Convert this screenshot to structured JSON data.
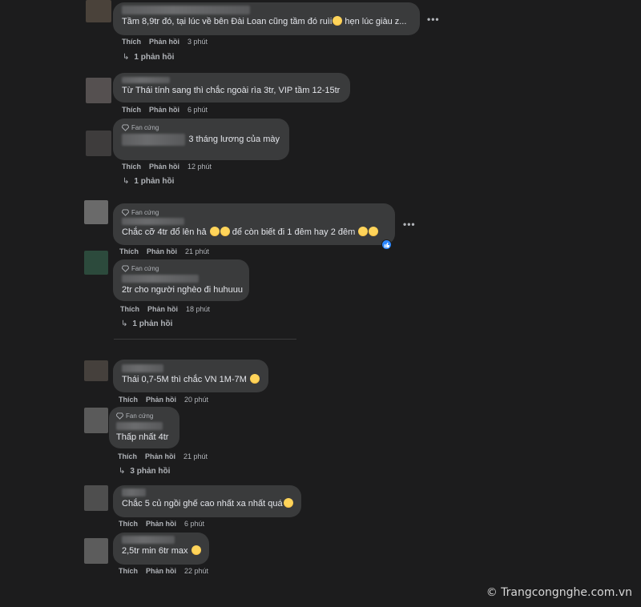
{
  "comments": [
    {
      "badge": "",
      "name": "",
      "text": "Tầm 8,9tr đó, tại lúc về bên Đài Loan cũng tầm đó ruìi",
      "text_tail": " hẹn lúc giàu z...",
      "like": "Thích",
      "reply": "Phản hồi",
      "time": "3 phút",
      "replies": "1 phản hồi"
    },
    {
      "badge": "",
      "name": "Nguyễn Vũ",
      "text": "Từ Thái tính sang thì chắc ngoài rìa 3tr, VIP tầm 12-15tr",
      "like": "Thích",
      "reply": "Phản hồi",
      "time": "6 phút"
    },
    {
      "badge": "Fan cứng",
      "name": "",
      "text": "3 tháng lương của mày",
      "like": "Thích",
      "reply": "Phản hồi",
      "time": "12 phút",
      "replies": "1 phản hồi"
    },
    {
      "badge": "Fan cứng",
      "name": "",
      "text": "Chắc cỡ 4tr đổ lên hả",
      "text_tail": " để còn biết đi 1 đêm hay 2 đêm",
      "like": "Thích",
      "reply": "Phản hồi",
      "time": "21 phút"
    },
    {
      "badge": "Fan cứng",
      "name": "",
      "text": "2tr cho người nghèo đi huhuuu",
      "like": "Thích",
      "reply": "Phản hồi",
      "time": "18 phút",
      "replies": "1 phản hồi"
    },
    {
      "badge": "",
      "name": "",
      "text": "Thái 0,7-5M thì chắc VN 1M-7M",
      "like": "Thích",
      "reply": "Phản hồi",
      "time": "20 phút"
    },
    {
      "badge": "Fan cứng",
      "name": "",
      "text": "Thấp nhất 4tr",
      "like": "Thích",
      "reply": "Phản hồi",
      "time": "21 phút",
      "replies": "3 phản hồi"
    },
    {
      "badge": "",
      "name": "",
      "text": "Chắc 5 củ ngồi ghế cao nhất xa nhất quá",
      "like": "Thích",
      "reply": "Phản hồi",
      "time": "6 phút"
    },
    {
      "badge": "",
      "name": "",
      "text": "2,5tr min 6tr max",
      "like": "Thích",
      "reply": "Phản hồi",
      "time": "22 phút"
    }
  ],
  "more_label": "•••",
  "watermark": "© Trangcongnghe.com.vn",
  "colors": {
    "background": "#1c1c1d",
    "bubble": "#3a3b3c",
    "text": "#e4e6eb",
    "muted": "#b0b3b8",
    "like_blue": "#2d88ff"
  }
}
